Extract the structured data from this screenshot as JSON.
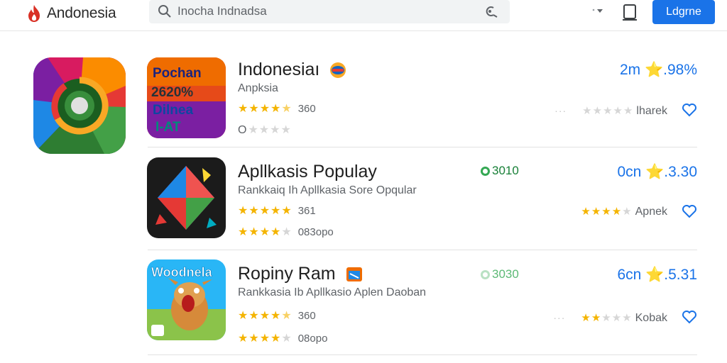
{
  "header": {
    "brand": "Andonesia",
    "search_placeholder": "Inocha Indnadsa",
    "login_label": "Ldgrne"
  },
  "rows": [
    {
      "title": "Indonesiaı",
      "subtitle": "Anpksia",
      "rating_stars": 4.5,
      "rating_count": "360",
      "second_prefix": "O",
      "second_stars": 0,
      "price": "2m ⭐.98%",
      "right_label": "lharek",
      "right_stars": 0,
      "icon_text": [
        "Pochan",
        "2620%",
        "Dilnea",
        "I-AT"
      ]
    },
    {
      "title": "Apllkasis Populay",
      "subtitle": "Rankkaiq Ih Apllkasia Sore Opqular",
      "rating_stars": 5,
      "rating_count": "361",
      "second_stars": 4,
      "second_count": "083opo",
      "badge": "3010",
      "price": "0cn ⭐.3.30",
      "right_label": "Apnek",
      "right_stars": 4
    },
    {
      "title": "Ropiny Ram",
      "subtitle": "Rankkasia Ib Apllkasio Aplen Daoban",
      "rating_stars": 4.5,
      "rating_count": "360",
      "second_stars": 4,
      "second_count": "08opo",
      "badge": "3030",
      "price": "6cn ⭐.5.31",
      "right_label": "Kobak",
      "right_stars": 2,
      "icon_text": "Woodnela"
    }
  ],
  "colors": {
    "accent": "#1a73e8",
    "star": "#f4b400",
    "badge_green": "#34a853"
  },
  "icons": [
    "brand-flame-icon",
    "search-icon",
    "voice-search-icon",
    "chevron-down-icon",
    "bag-icon",
    "heart-icon",
    "more-dots-icon"
  ]
}
